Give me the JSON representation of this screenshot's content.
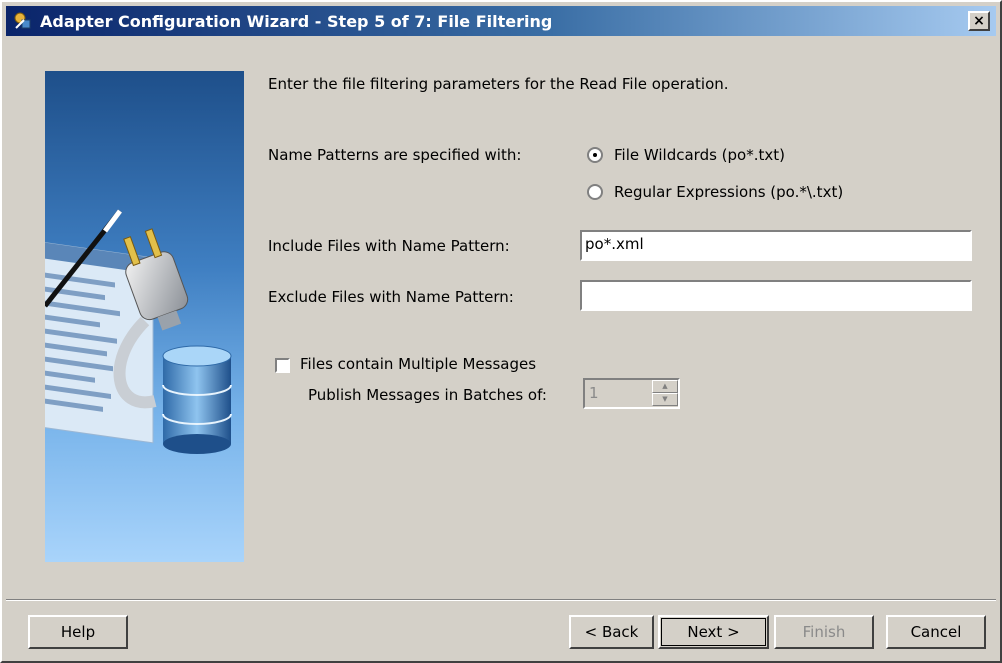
{
  "window": {
    "title": "Adapter Configuration Wizard - Step 5 of 7: File Filtering",
    "close_glyph": "×"
  },
  "main": {
    "instruction": "Enter the file filtering parameters for the Read File operation.",
    "patterns_label": "Name Patterns are specified with:",
    "radio_options": [
      {
        "label": "File Wildcards (po*.txt)",
        "selected": true
      },
      {
        "label": "Regular Expressions (po.*\\.txt)",
        "selected": false
      }
    ],
    "include_label": "Include Files with Name Pattern:",
    "include_value": "po*.xml",
    "exclude_label": "Exclude Files with Name Pattern:",
    "exclude_value": "",
    "multi_messages_label": "Files contain Multiple Messages",
    "multi_messages_checked": false,
    "batch_label": "Publish Messages in Batches of:",
    "batch_value": "1"
  },
  "buttons": {
    "help": "Help",
    "back": "< Back",
    "next": "Next >",
    "finish": "Finish",
    "cancel": "Cancel"
  },
  "icons": {
    "app": "wizard-wand-icon",
    "close": "close-icon",
    "side_illustration": "adapter-plug-database-illustration"
  },
  "colors": {
    "titlebar_start": "#0a246a",
    "titlebar_end": "#a6caf0",
    "dialog_bg": "#d4d0c8",
    "panel_blue": "#3f7fc2"
  }
}
